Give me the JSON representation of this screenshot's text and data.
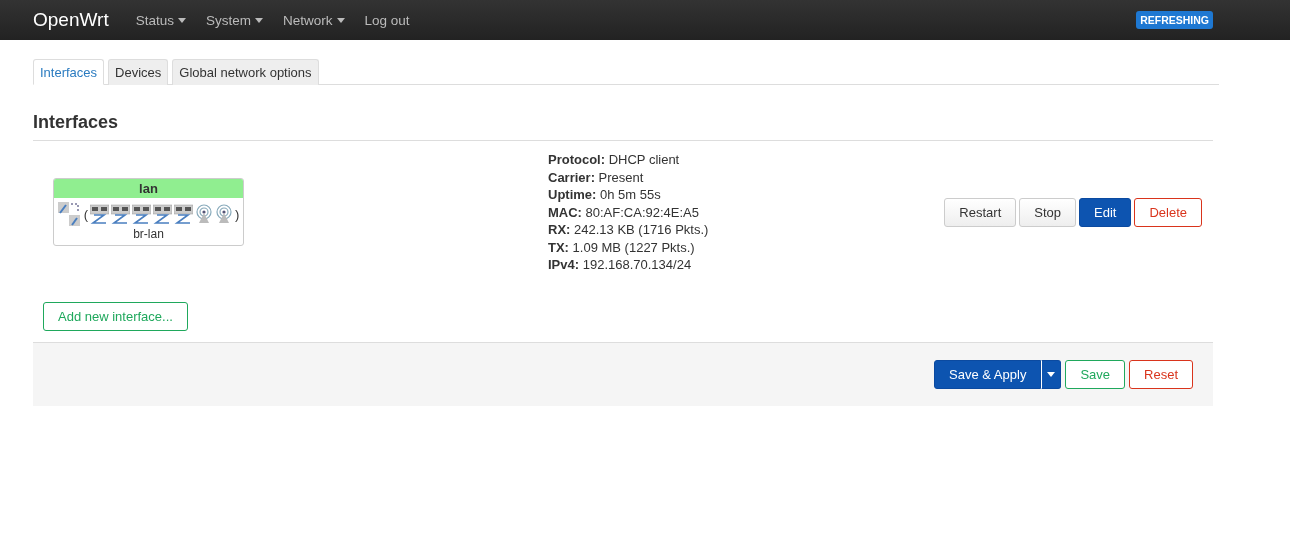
{
  "header": {
    "brand": "OpenWrt",
    "menu": [
      {
        "label": "Status",
        "dropdown": true
      },
      {
        "label": "System",
        "dropdown": true
      },
      {
        "label": "Network",
        "dropdown": true
      },
      {
        "label": "Log out",
        "dropdown": false
      }
    ],
    "badge": "REFRESHING"
  },
  "tabs": [
    {
      "label": "Interfaces",
      "selected": true
    },
    {
      "label": "Devices",
      "selected": false
    },
    {
      "label": "Global network options",
      "selected": false
    }
  ],
  "section_title": "Interfaces",
  "interfaces": [
    {
      "name": "lan",
      "color": "#90ee90",
      "bracket_open": "(",
      "bracket_close": ")",
      "device": "br-lan",
      "details": [
        "**Protocol:** DHCP client",
        "**Carrier:** Present",
        "**Uptime:** 0h 5m 55s",
        "**MAC:** 80:AF:CA:92:4E:A5",
        "**RX:** 242.13 KB (1716 Pkts.)",
        "**TX:** 1.09 MB (1227 Pkts.)",
        "**IPv4:** 192.168.70.134/24"
      ],
      "buttons": [
        {
          "label": "Restart",
          "kind": "default"
        },
        {
          "label": "Stop",
          "kind": "default"
        },
        {
          "label": "Edit",
          "kind": "primary"
        },
        {
          "label": "Delete",
          "kind": "negative"
        }
      ]
    }
  ],
  "add_button": "Add new interface...",
  "footer_buttons": [
    {
      "label": "Save & Apply",
      "kind": "primary",
      "dropdown": true
    },
    {
      "label": "Save",
      "kind": "positive",
      "dropdown": false
    },
    {
      "label": "Reset",
      "kind": "negative",
      "dropdown": false
    }
  ]
}
